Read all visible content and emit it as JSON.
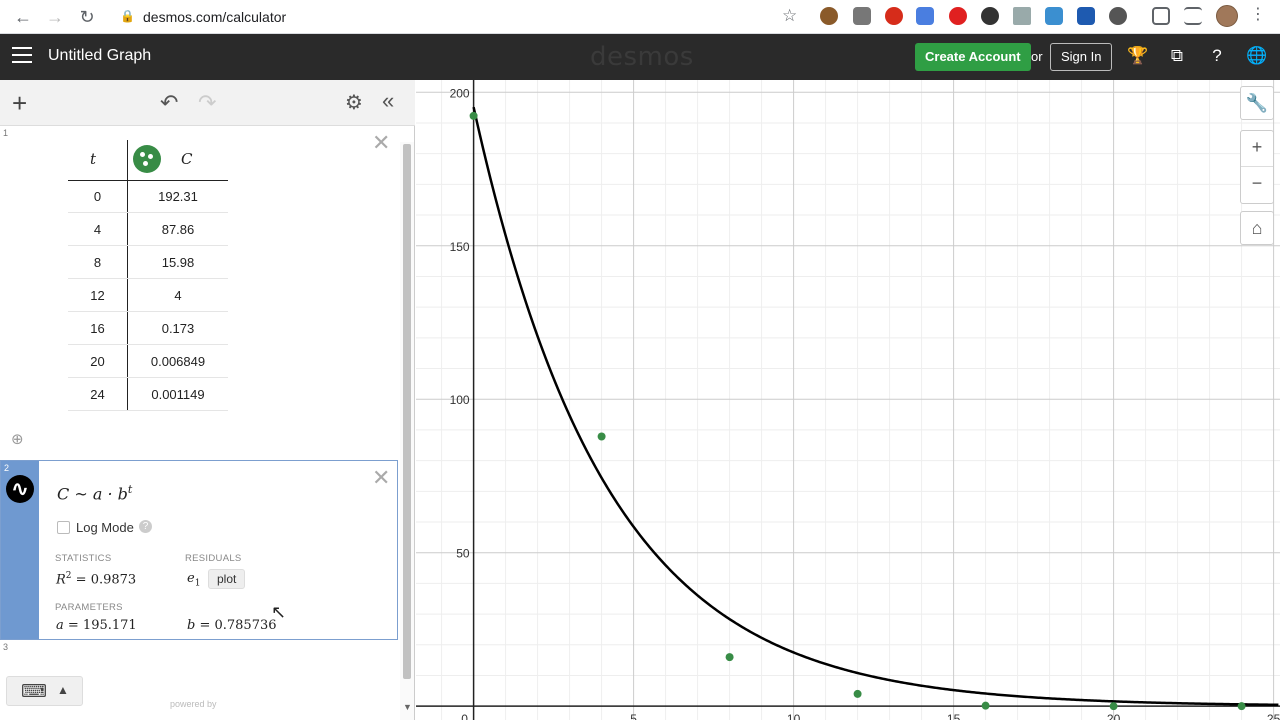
{
  "browser": {
    "url": "desmos.com/calculator"
  },
  "header": {
    "title": "Untitled Graph",
    "logo": "desmos",
    "create_account": "Create Account",
    "or": "or",
    "sign_in": "Sign In"
  },
  "expressions": {
    "table": {
      "number": "1",
      "columns": [
        "t",
        "C"
      ],
      "rows": [
        [
          "0",
          "192.31"
        ],
        [
          "4",
          "87.86"
        ],
        [
          "8",
          "15.98"
        ],
        [
          "12",
          "4"
        ],
        [
          "16",
          "0.173"
        ],
        [
          "20",
          "0.006849"
        ],
        [
          "24",
          "0.001149"
        ]
      ],
      "point_color": "#388c46"
    },
    "regression": {
      "number": "2",
      "formula_main": "C ~ a · b",
      "formula_exp": "t",
      "log_mode_label": "Log Mode",
      "statistics_label": "STATISTICS",
      "residuals_label": "RESIDUALS",
      "parameters_label": "PARAMETERS",
      "r2_lhs": "R",
      "r2_sup": "2",
      "r2_val": " = 0.9873",
      "e_var": "e",
      "e_sub": "1",
      "plot_label": "plot",
      "a_lhs": "a",
      "a_val": " = 195.171",
      "b_lhs": "b",
      "b_val": " = 0.785736",
      "accent": "#6f99d0"
    },
    "empty": {
      "number": "3"
    }
  },
  "footer": {
    "powered_by": "powered by"
  },
  "chart_data": {
    "type": "scatter",
    "x": [
      0,
      4,
      8,
      12,
      16,
      20,
      24
    ],
    "y": [
      192.31,
      87.86,
      15.98,
      4,
      0.173,
      0.006849,
      0.001149
    ],
    "curve": {
      "a": 195.171,
      "b": 0.785736,
      "color": "#000000"
    },
    "point_color": "#388c46",
    "x_ticks": [
      "0",
      "5",
      "10",
      "15",
      "20",
      "25"
    ],
    "y_ticks": [
      "50",
      "100",
      "150",
      "200"
    ],
    "xlim": [
      -1.8,
      25.2
    ],
    "ylim": [
      -4.5,
      204
    ],
    "grid": true
  }
}
